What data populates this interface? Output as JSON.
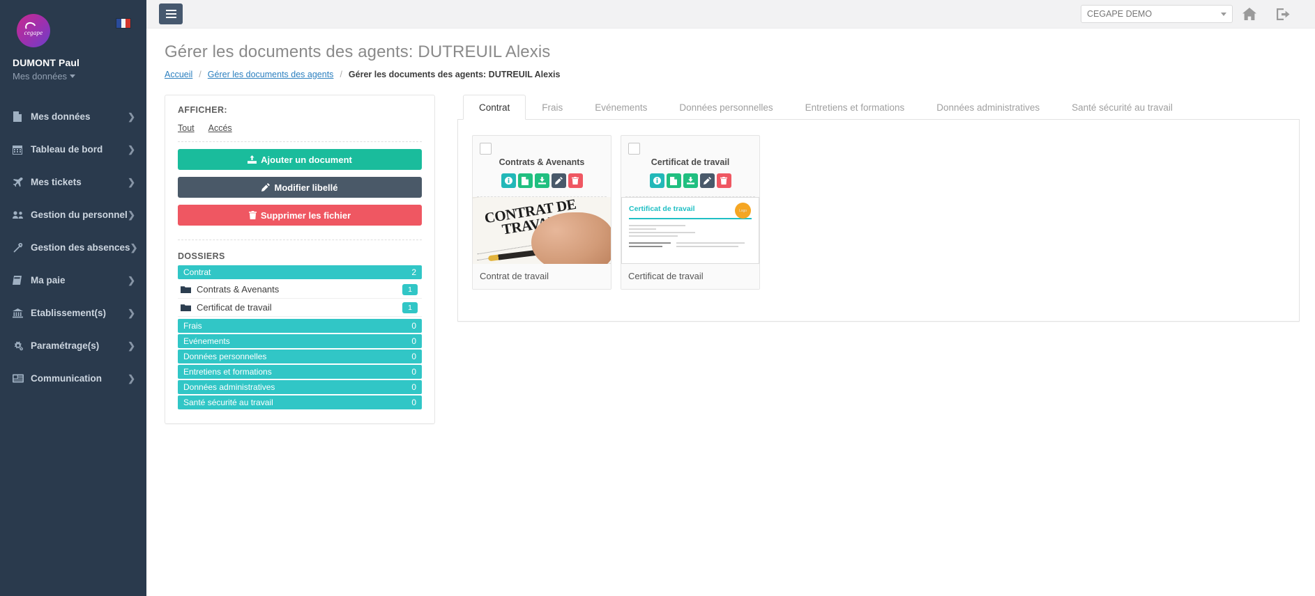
{
  "sidebar": {
    "user_name": "DUMONT Paul",
    "user_menu": "Mes données",
    "brand_logo_text": "cegape",
    "flag": "france-flag",
    "items": [
      {
        "label": "Mes données",
        "icon": "file-icon"
      },
      {
        "label": "Tableau de bord",
        "icon": "calendar-icon"
      },
      {
        "label": "Mes tickets",
        "icon": "plane-icon"
      },
      {
        "label": "Gestion du personnel",
        "icon": "users-icon"
      },
      {
        "label": "Gestion des absences",
        "icon": "link-icon"
      },
      {
        "label": "Ma paie",
        "icon": "book-icon"
      },
      {
        "label": "Etablissement(s)",
        "icon": "bank-icon"
      },
      {
        "label": "Paramétrage(s)",
        "icon": "gears-icon"
      },
      {
        "label": "Communication",
        "icon": "newspaper-icon"
      }
    ]
  },
  "topbar": {
    "menu_toggle": "hamburger-icon",
    "org_value": "CEGAPE DEMO",
    "home_icon": "home-icon",
    "logout_icon": "logout-icon"
  },
  "page": {
    "title": "Gérer les documents des agents: DUTREUIL Alexis",
    "breadcrumb": [
      {
        "label": "Accueil",
        "current": false
      },
      {
        "label": "Gérer les documents des agents",
        "current": false
      },
      {
        "label": "Gérer les documents des agents: DUTREUIL Alexis",
        "current": true
      }
    ]
  },
  "left_panel": {
    "afficher_label": "AFFICHER:",
    "filters": [
      "Tout",
      "Accés"
    ],
    "buttons": [
      {
        "label": "Ajouter un document",
        "icon": "upload-icon",
        "color": "#1abc9c"
      },
      {
        "label": "Modifier libellé",
        "icon": "pencil-icon",
        "color": "#4a5968"
      },
      {
        "label": "Supprimer les fichier",
        "icon": "trash-icon",
        "color": "#ef5762"
      }
    ],
    "dossiers_label": "DOSSIERS",
    "tree": [
      {
        "type": "category",
        "label": "Contrat",
        "count": "2"
      },
      {
        "type": "folder",
        "label": "Contrats & Avenants",
        "count": "1"
      },
      {
        "type": "folder",
        "label": "Certificat de travail",
        "count": "1"
      },
      {
        "type": "category",
        "label": "Frais",
        "count": "0"
      },
      {
        "type": "category",
        "label": "Evénements",
        "count": "0"
      },
      {
        "type": "category",
        "label": "Données personnelles",
        "count": "0"
      },
      {
        "type": "category",
        "label": "Entretiens et formations",
        "count": "0"
      },
      {
        "type": "category",
        "label": "Données administratives",
        "count": "0"
      },
      {
        "type": "category",
        "label": "Santé sécurité au travail",
        "count": "0"
      }
    ]
  },
  "tabs": [
    {
      "label": "Contrat",
      "active": true
    },
    {
      "label": "Frais",
      "active": false
    },
    {
      "label": "Evénements",
      "active": false
    },
    {
      "label": "Données personnelles",
      "active": false
    },
    {
      "label": "Entretiens et formations",
      "active": false
    },
    {
      "label": "Données administratives",
      "active": false
    },
    {
      "label": "Santé sécurité au travail",
      "active": false
    }
  ],
  "documents": [
    {
      "folder_title": "Contrats & Avenants",
      "file_name": "Contrat de travail",
      "preview_kind": "photo-contrat",
      "preview_text_line1": "CONTRAT DE",
      "preview_text_line2": "TRAVAIL",
      "actions": [
        {
          "name": "info-icon",
          "color": "#22b8b8"
        },
        {
          "name": "file-icon",
          "color": "#20bf80"
        },
        {
          "name": "download-icon",
          "color": "#20bf80"
        },
        {
          "name": "pencil-icon",
          "color": "#49596a"
        },
        {
          "name": "trash-icon",
          "color": "#ef5762"
        }
      ]
    },
    {
      "folder_title": "Certificat de travail",
      "file_name": "Certificat de travail",
      "preview_kind": "doc-certificat",
      "preview_heading": "Certificat de travail",
      "actions": [
        {
          "name": "info-icon",
          "color": "#22b8b8"
        },
        {
          "name": "file-icon",
          "color": "#20bf80"
        },
        {
          "name": "download-icon",
          "color": "#20bf80"
        },
        {
          "name": "pencil-icon",
          "color": "#49596a"
        },
        {
          "name": "trash-icon",
          "color": "#ef5762"
        }
      ]
    }
  ],
  "colors": {
    "sidebar_bg": "#2a3a4d",
    "accent_teal": "#31c6c6",
    "accent_green": "#1abc9c",
    "accent_red": "#ef5762",
    "accent_slate": "#4a5968",
    "link_blue": "#2b7fbf"
  }
}
